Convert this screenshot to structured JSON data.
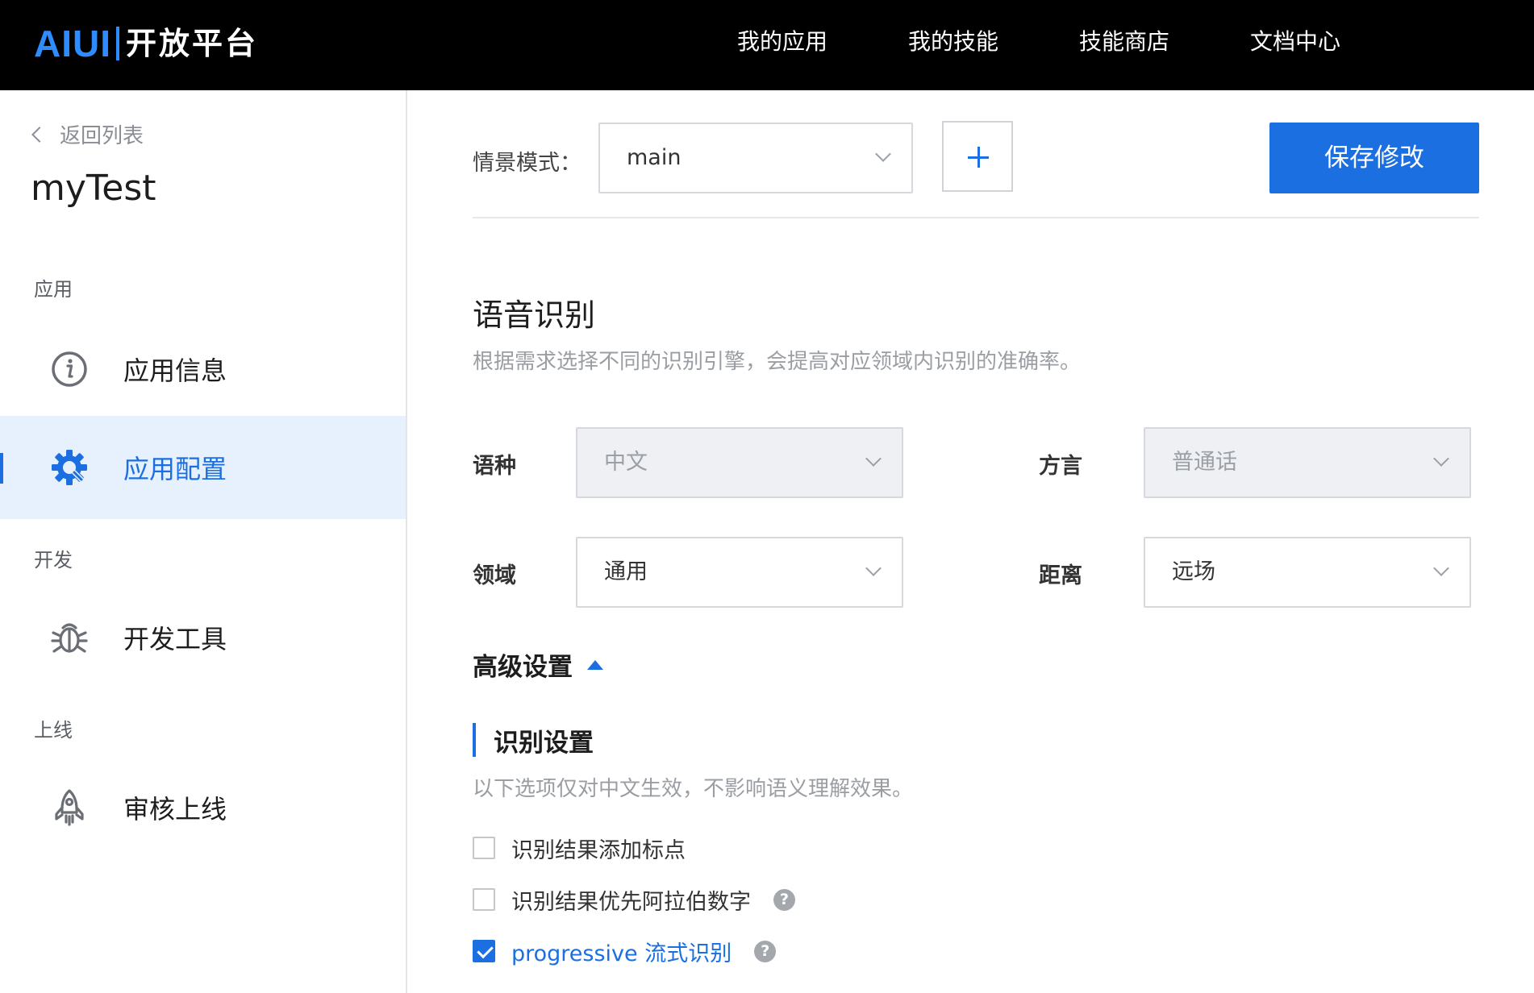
{
  "header": {
    "logo_mark": "AIUI",
    "logo_name": "开放平台",
    "nav": [
      "我的应用",
      "我的技能",
      "技能商店",
      "文档中心"
    ]
  },
  "sidebar": {
    "back_label": "返回列表",
    "app_name": "myTest",
    "groups": {
      "app": "应用",
      "dev": "开发",
      "online": "上线"
    },
    "items": [
      {
        "label": "应用信息",
        "icon": "info-icon"
      },
      {
        "label": "应用配置",
        "icon": "gear-icon",
        "active": true
      },
      {
        "label": "开发工具",
        "icon": "bug-icon"
      },
      {
        "label": "审核上线",
        "icon": "rocket-icon"
      }
    ]
  },
  "toolbar": {
    "scene_label": "情景模式：",
    "scene_value": "main",
    "save_label": "保存修改"
  },
  "asr": {
    "title": "语音识别",
    "description": "根据需求选择不同的识别引擎，会提高对应领域内识别的准确率。",
    "language": {
      "label": "语种",
      "value": "中文",
      "disabled": true
    },
    "dialect": {
      "label": "方言",
      "value": "普通话",
      "disabled": true
    },
    "domain": {
      "label": "领域",
      "value": "通用"
    },
    "distance": {
      "label": "距离",
      "value": "远场"
    }
  },
  "advanced": {
    "label": "高级设置",
    "subsection_title": "识别设置",
    "subsection_desc": "以下选项仅对中文生效，不影响语义理解效果。",
    "options": [
      {
        "label": "识别结果添加标点",
        "checked": false,
        "help": false
      },
      {
        "label": "识别结果优先阿拉伯数字",
        "checked": false,
        "help": true
      },
      {
        "label": "progressive 流式识别",
        "checked": true,
        "help": true
      }
    ],
    "help_glyph": "?"
  },
  "colors": {
    "accent": "#1b6fe0",
    "active_bg": "#e6f1fd",
    "topbar_bg": "#000000"
  }
}
